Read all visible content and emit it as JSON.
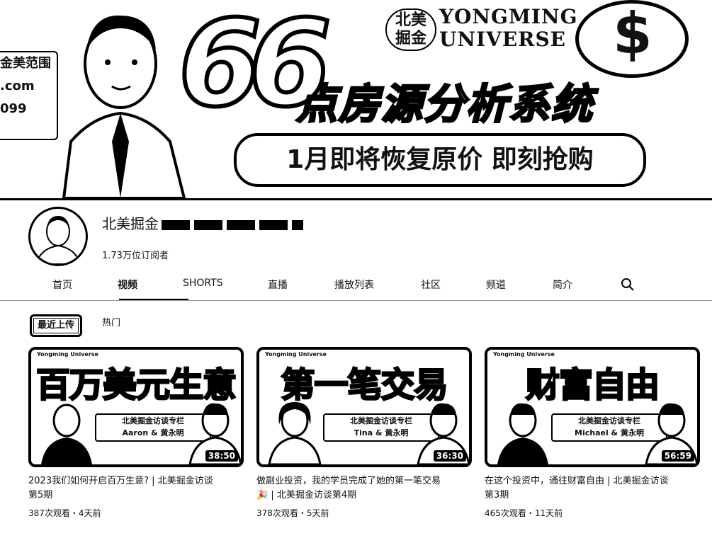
{
  "banner": {
    "left_card_lines": [
      "金美范围",
      ".com",
      "099"
    ],
    "brand_cn": "北美掘金",
    "brand_en_line1": "YONGMING",
    "brand_en_line2": "UNIVERSE",
    "big_number": "66",
    "headline": "点房源分析系统",
    "pill_text": "1月即将恢复原价 即刻抢购",
    "coin_symbol": "$"
  },
  "channel": {
    "name": "北美掘金",
    "subscribers": "1.73万位订阅者"
  },
  "tabs": [
    {
      "label": "首页"
    },
    {
      "label": "视频"
    },
    {
      "label": "SHORTS"
    },
    {
      "label": "直播"
    },
    {
      "label": "播放列表"
    },
    {
      "label": "社区"
    },
    {
      "label": "频道"
    },
    {
      "label": "简介"
    }
  ],
  "active_tab": "视频",
  "search_icon": "search-icon",
  "chips": {
    "recent": "最近上传",
    "popular": "热门"
  },
  "videos": [
    {
      "thumb_text": "百万美元生意",
      "thumb_logo": "Yongming Universe",
      "strip_line1": "北美掘金访谈专栏",
      "strip_line2": "Aaron & 黄永明",
      "duration": "38:50",
      "title_line1": "2023我们如何开启百万生意? | 北美掘金访谈",
      "title_line2": "第5期",
      "meta": "387次观看・4天前"
    },
    {
      "thumb_text": "第一笔交易",
      "thumb_logo": "Yongming Universe",
      "strip_line1": "北美掘金访谈专栏",
      "strip_line2": "Tina & 黄永明",
      "duration": "36:30",
      "title_line1": "做副业投资，我的学员完成了她的第一笔交易",
      "title_line2": "🎉 | 北美掘金访谈第4期",
      "meta": "378次观看・5天前"
    },
    {
      "thumb_text": "财富自由",
      "thumb_logo": "Yongming Universe",
      "strip_line1": "北美掘金访谈专栏",
      "strip_line2": "Michael & 黄永明",
      "duration": "56:59",
      "title_line1": "在这个投资中，通往财富自由 | 北美掘金访谈",
      "title_line2": "第3期",
      "meta": "465次观看・11天前"
    }
  ]
}
